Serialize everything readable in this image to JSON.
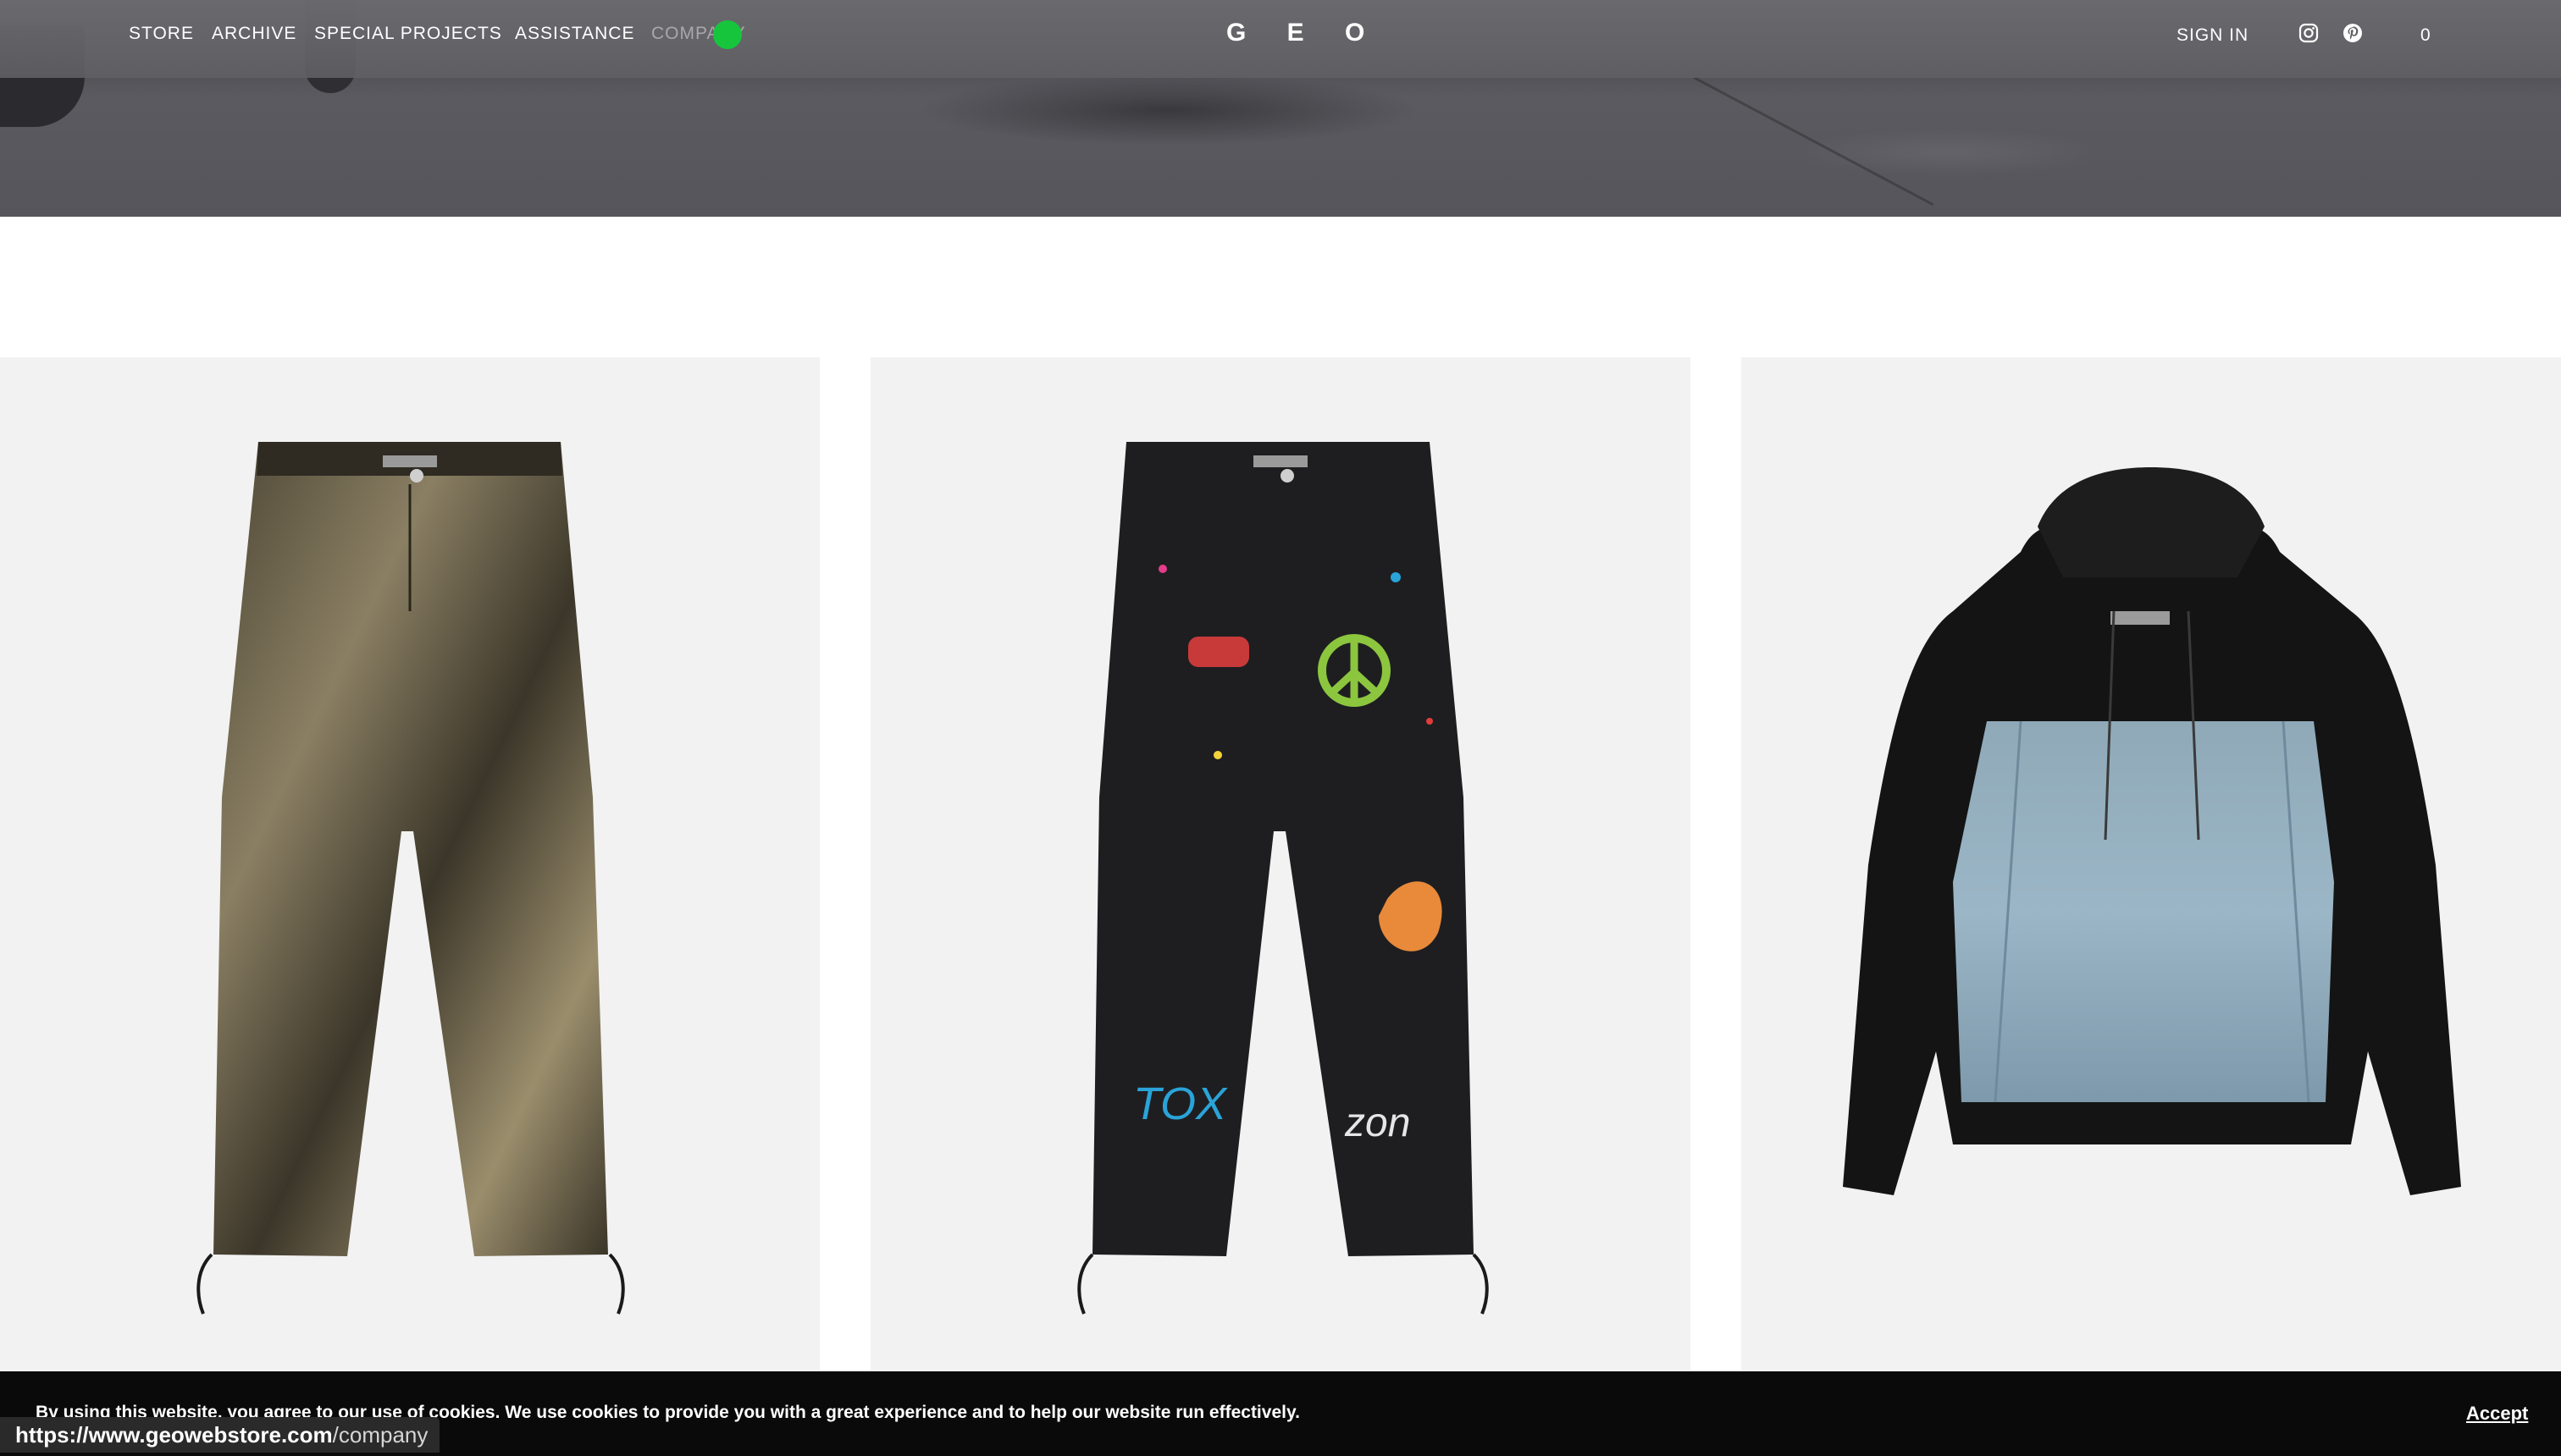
{
  "nav": {
    "links": [
      "STORE",
      "ARCHIVE",
      "SPECIAL PROJECTS",
      "ASSISTANCE",
      "COMPANY"
    ],
    "logo": "G E O",
    "sign_in": "SIGN IN",
    "cart_count": "0",
    "social_icons": [
      "instagram-icon",
      "pinterest-icon"
    ]
  },
  "products": [
    {
      "image": "camo-print-drawstring-jeans"
    },
    {
      "image": "graffiti-paint-splatter-jeans"
    },
    {
      "image": "denim-panel-black-hoodie"
    }
  ],
  "cookie_banner": {
    "message": "By using this website, you agree to our use of cookies. We use cookies to provide you with a great experience and to help our website run effectively.",
    "accept_label": "Accept"
  },
  "status_url": {
    "host": "https://www.geowebstore.com",
    "path": "/company"
  },
  "colors": {
    "cursor_highlight": "#17c53c",
    "card_background": "#f2f2f2",
    "cookie_bar": "#0a0a0a"
  }
}
